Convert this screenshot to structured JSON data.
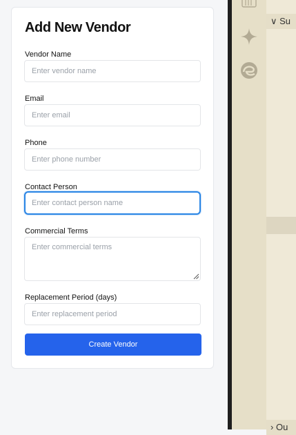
{
  "form": {
    "title": "Add New Vendor",
    "fields": [
      {
        "label": "Vendor Name",
        "placeholder": "Enter vendor name"
      },
      {
        "label": "Email",
        "placeholder": "Enter email"
      },
      {
        "label": "Phone",
        "placeholder": "Enter phone number"
      },
      {
        "label": "Contact Person",
        "placeholder": "Enter contact person name"
      },
      {
        "label": "Commercial Terms",
        "placeholder": "Enter commercial terms"
      },
      {
        "label": "Replacement Period (days)",
        "placeholder": "Enter replacement period"
      }
    ],
    "submit_label": "Create Vendor"
  },
  "side_panel": {
    "section_top_label": "Su",
    "section_bottom_label": "Ou",
    "icons": [
      "library-icon",
      "sparkle-icon",
      "edge-browser-icon"
    ]
  },
  "colors": {
    "primary": "#2563eb",
    "focus_ring": "#2b86e5",
    "panel_bg": "#efe9d7",
    "activity_bar_bg": "#e6dfc8"
  }
}
